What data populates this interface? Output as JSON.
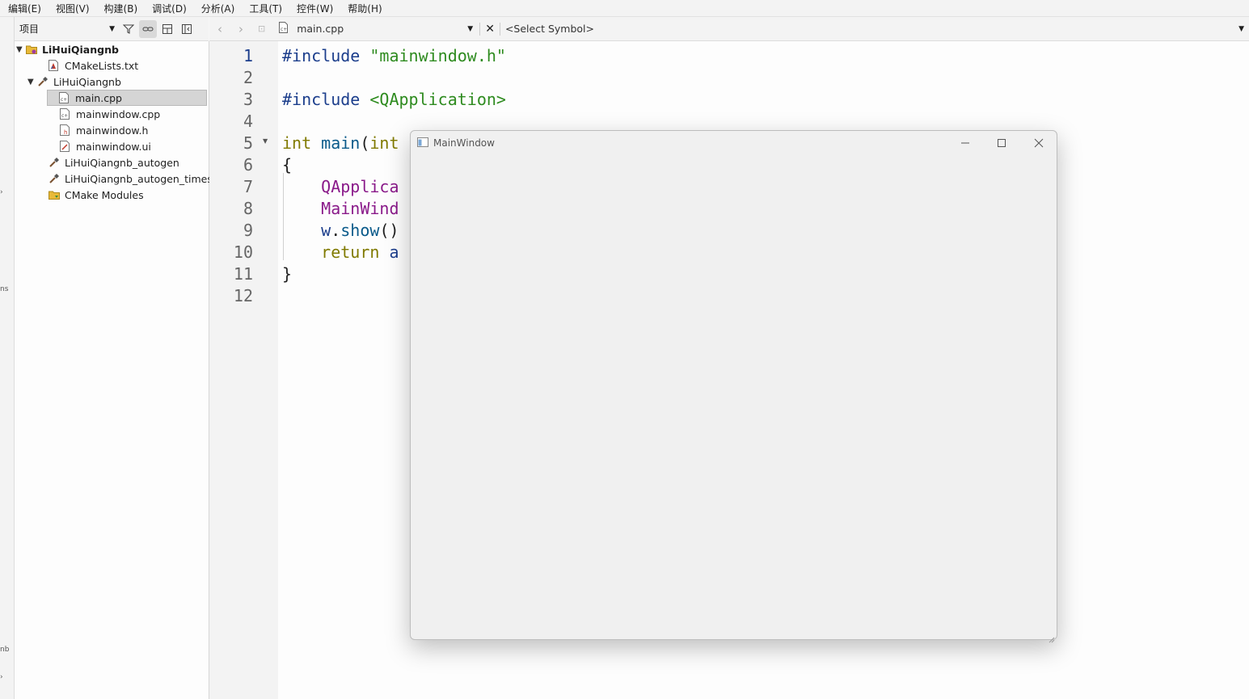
{
  "menubar": [
    "编辑(E)",
    "视图(V)",
    "构建(B)",
    "调试(D)",
    "分析(A)",
    "工具(T)",
    "控件(W)",
    "帮助(H)"
  ],
  "project_panel": {
    "combo_label": "项目",
    "tree": [
      {
        "label": "LiHuiQiangnb",
        "kind": "project",
        "bold": true
      },
      {
        "label": "CMakeLists.txt",
        "kind": "cmake-file"
      },
      {
        "label": "LiHuiQiangnb",
        "kind": "target"
      },
      {
        "label": "main.cpp",
        "kind": "cpp-file",
        "selected": true
      },
      {
        "label": "mainwindow.cpp",
        "kind": "cpp-file"
      },
      {
        "label": "mainwindow.h",
        "kind": "header-file"
      },
      {
        "label": "mainwindow.ui",
        "kind": "ui-file"
      },
      {
        "label": "LiHuiQiangnb_autogen",
        "kind": "target"
      },
      {
        "label": "LiHuiQiangnb_autogen_timestam",
        "kind": "target"
      },
      {
        "label": "CMake Modules",
        "kind": "folder"
      }
    ]
  },
  "left_strip": {
    "top_mark": "ns",
    "bottom_mark": "nb"
  },
  "editor": {
    "file_name": "main.cpp",
    "symbol_placeholder": "<Select Symbol>",
    "line_numbers": [
      "1",
      "2",
      "3",
      "4",
      "5",
      "6",
      "7",
      "8",
      "9",
      "10",
      "11",
      "12"
    ],
    "lines": [
      [
        {
          "t": "#include ",
          "c": "pre"
        },
        {
          "t": "\"mainwindow.h\"",
          "c": "str"
        }
      ],
      [],
      [
        {
          "t": "#include ",
          "c": "pre"
        },
        {
          "t": "<QApplication>",
          "c": "str"
        }
      ],
      [],
      [
        {
          "t": "int ",
          "c": "type"
        },
        {
          "t": "main",
          "c": "fn"
        },
        {
          "t": "(",
          "c": "plain"
        },
        {
          "t": "int",
          "c": "type"
        }
      ],
      [
        {
          "t": "{",
          "c": "plain"
        }
      ],
      [
        {
          "t": "    ",
          "c": "plain"
        },
        {
          "t": "QApplica",
          "c": "cls"
        }
      ],
      [
        {
          "t": "    ",
          "c": "plain"
        },
        {
          "t": "MainWind",
          "c": "cls"
        }
      ],
      [
        {
          "t": "    ",
          "c": "plain"
        },
        {
          "t": "w",
          "c": "var"
        },
        {
          "t": ".",
          "c": "plain"
        },
        {
          "t": "show",
          "c": "fn"
        },
        {
          "t": "()",
          "c": "plain"
        }
      ],
      [
        {
          "t": "    ",
          "c": "plain"
        },
        {
          "t": "return ",
          "c": "type"
        },
        {
          "t": "a",
          "c": "var"
        }
      ],
      [
        {
          "t": "}",
          "c": "plain"
        }
      ],
      []
    ]
  },
  "main_window": {
    "title": "MainWindow"
  },
  "colors": {
    "accent": "#1c3e8c",
    "string": "#2e8b1f",
    "keyword": "#807a00",
    "class": "#8a1a8a"
  }
}
